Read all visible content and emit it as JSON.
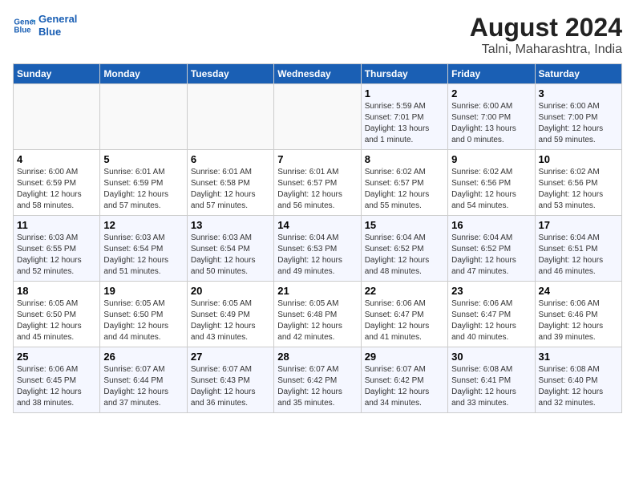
{
  "header": {
    "logo_line1": "General",
    "logo_line2": "Blue",
    "main_title": "August 2024",
    "subtitle": "Talni, Maharashtra, India"
  },
  "weekdays": [
    "Sunday",
    "Monday",
    "Tuesday",
    "Wednesday",
    "Thursday",
    "Friday",
    "Saturday"
  ],
  "weeks": [
    [
      {
        "day": "",
        "info": ""
      },
      {
        "day": "",
        "info": ""
      },
      {
        "day": "",
        "info": ""
      },
      {
        "day": "",
        "info": ""
      },
      {
        "day": "1",
        "info": "Sunrise: 5:59 AM\nSunset: 7:01 PM\nDaylight: 13 hours and 1 minute."
      },
      {
        "day": "2",
        "info": "Sunrise: 6:00 AM\nSunset: 7:00 PM\nDaylight: 13 hours and 0 minutes."
      },
      {
        "day": "3",
        "info": "Sunrise: 6:00 AM\nSunset: 7:00 PM\nDaylight: 12 hours and 59 minutes."
      }
    ],
    [
      {
        "day": "4",
        "info": "Sunrise: 6:00 AM\nSunset: 6:59 PM\nDaylight: 12 hours and 58 minutes."
      },
      {
        "day": "5",
        "info": "Sunrise: 6:01 AM\nSunset: 6:59 PM\nDaylight: 12 hours and 57 minutes."
      },
      {
        "day": "6",
        "info": "Sunrise: 6:01 AM\nSunset: 6:58 PM\nDaylight: 12 hours and 57 minutes."
      },
      {
        "day": "7",
        "info": "Sunrise: 6:01 AM\nSunset: 6:57 PM\nDaylight: 12 hours and 56 minutes."
      },
      {
        "day": "8",
        "info": "Sunrise: 6:02 AM\nSunset: 6:57 PM\nDaylight: 12 hours and 55 minutes."
      },
      {
        "day": "9",
        "info": "Sunrise: 6:02 AM\nSunset: 6:56 PM\nDaylight: 12 hours and 54 minutes."
      },
      {
        "day": "10",
        "info": "Sunrise: 6:02 AM\nSunset: 6:56 PM\nDaylight: 12 hours and 53 minutes."
      }
    ],
    [
      {
        "day": "11",
        "info": "Sunrise: 6:03 AM\nSunset: 6:55 PM\nDaylight: 12 hours and 52 minutes."
      },
      {
        "day": "12",
        "info": "Sunrise: 6:03 AM\nSunset: 6:54 PM\nDaylight: 12 hours and 51 minutes."
      },
      {
        "day": "13",
        "info": "Sunrise: 6:03 AM\nSunset: 6:54 PM\nDaylight: 12 hours and 50 minutes."
      },
      {
        "day": "14",
        "info": "Sunrise: 6:04 AM\nSunset: 6:53 PM\nDaylight: 12 hours and 49 minutes."
      },
      {
        "day": "15",
        "info": "Sunrise: 6:04 AM\nSunset: 6:52 PM\nDaylight: 12 hours and 48 minutes."
      },
      {
        "day": "16",
        "info": "Sunrise: 6:04 AM\nSunset: 6:52 PM\nDaylight: 12 hours and 47 minutes."
      },
      {
        "day": "17",
        "info": "Sunrise: 6:04 AM\nSunset: 6:51 PM\nDaylight: 12 hours and 46 minutes."
      }
    ],
    [
      {
        "day": "18",
        "info": "Sunrise: 6:05 AM\nSunset: 6:50 PM\nDaylight: 12 hours and 45 minutes."
      },
      {
        "day": "19",
        "info": "Sunrise: 6:05 AM\nSunset: 6:50 PM\nDaylight: 12 hours and 44 minutes."
      },
      {
        "day": "20",
        "info": "Sunrise: 6:05 AM\nSunset: 6:49 PM\nDaylight: 12 hours and 43 minutes."
      },
      {
        "day": "21",
        "info": "Sunrise: 6:05 AM\nSunset: 6:48 PM\nDaylight: 12 hours and 42 minutes."
      },
      {
        "day": "22",
        "info": "Sunrise: 6:06 AM\nSunset: 6:47 PM\nDaylight: 12 hours and 41 minutes."
      },
      {
        "day": "23",
        "info": "Sunrise: 6:06 AM\nSunset: 6:47 PM\nDaylight: 12 hours and 40 minutes."
      },
      {
        "day": "24",
        "info": "Sunrise: 6:06 AM\nSunset: 6:46 PM\nDaylight: 12 hours and 39 minutes."
      }
    ],
    [
      {
        "day": "25",
        "info": "Sunrise: 6:06 AM\nSunset: 6:45 PM\nDaylight: 12 hours and 38 minutes."
      },
      {
        "day": "26",
        "info": "Sunrise: 6:07 AM\nSunset: 6:44 PM\nDaylight: 12 hours and 37 minutes."
      },
      {
        "day": "27",
        "info": "Sunrise: 6:07 AM\nSunset: 6:43 PM\nDaylight: 12 hours and 36 minutes."
      },
      {
        "day": "28",
        "info": "Sunrise: 6:07 AM\nSunset: 6:42 PM\nDaylight: 12 hours and 35 minutes."
      },
      {
        "day": "29",
        "info": "Sunrise: 6:07 AM\nSunset: 6:42 PM\nDaylight: 12 hours and 34 minutes."
      },
      {
        "day": "30",
        "info": "Sunrise: 6:08 AM\nSunset: 6:41 PM\nDaylight: 12 hours and 33 minutes."
      },
      {
        "day": "31",
        "info": "Sunrise: 6:08 AM\nSunset: 6:40 PM\nDaylight: 12 hours and 32 minutes."
      }
    ]
  ]
}
